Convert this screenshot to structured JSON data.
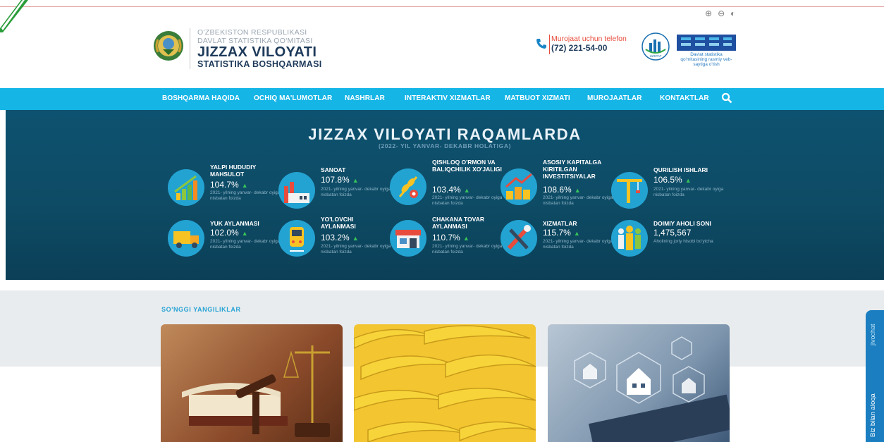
{
  "accessibility": {
    "zoom_in": "⊕",
    "zoom_out": "⊖",
    "contrast": "◐"
  },
  "header": {
    "org_line1": "O'ZBEKISTON RESPUBLIKASI",
    "org_line2": "DAVLAT STATISTIKA QO'MITASI",
    "title": "JIZZAX VILOYATI",
    "subtitle": "STATISTIKA BOSHQARMASI",
    "phone_label": "Murojaat uchun telefon",
    "phone_number": "(72) 221-54-00",
    "uzstat_label": "UZSTAT",
    "site_caption": "Davlat statistika qo'mitasining rasmiy veb-saytiga o'tish"
  },
  "nav": {
    "items": [
      "BOSHQARMA HAQIDA",
      "OCHIQ MA'LUMOTLAR",
      "NASHRLAR",
      "INTERAKTIV XIZMATLAR",
      "MATBUOT XIZMATI",
      "MUROJAATLAR",
      "KONTAKTLAR"
    ]
  },
  "hero": {
    "title": "JIZZAX VILOYATI RAQAMLARDA",
    "subtitle": "(2022- YIL YANVAR- DEKABR HOLATIGA)",
    "stats": [
      {
        "title": "YALPI HUDUDIY MAHSULOT",
        "value": "104.7%",
        "note": "2021- yilning yanvar- dekabr oyiga nisbatan foizda",
        "icon": "chart-bars-icon"
      },
      {
        "title": "SANOAT",
        "value": "107.8%",
        "note": "2021- yilning yanvar- dekabr oyiga nisbatan foizda",
        "icon": "factory-icon"
      },
      {
        "title": "QISHLOQ O'RMON VA BALIQCHILIK XO'JALIGI",
        "value": "103.4%",
        "note": "2021- yilning yanvar- dekabr oyiga nisbatan foizda",
        "icon": "wheat-gear-icon"
      },
      {
        "title": "ASOSIY KAPITALGA KIRITILGAN INVESTITSIYALAR",
        "value": "108.6%",
        "note": "2021- yilning yanvar- dekabr oyiga nisbatan foizda",
        "icon": "investment-chart-icon"
      },
      {
        "title": "QURILISH ISHLARI",
        "value": "106.5%",
        "note": "2021- yilning yanvar- dekabr oyiga nisbatan foizda",
        "icon": "crane-icon"
      },
      {
        "title": "YUK AYLANMASI",
        "value": "102.0%",
        "note": "2021- yilning yanvar- dekabr oyiga nisbatan foizda",
        "icon": "truck-icon"
      },
      {
        "title": "YO'LOVCHI AYLANMASI",
        "value": "103.2%",
        "note": "2021- yilning yanvar- dekabr oyiga nisbatan foizda",
        "icon": "train-icon"
      },
      {
        "title": "CHAKANA TOVAR AYLANMASI",
        "value": "110.7%",
        "note": "2021- yilning yanvar- dekabr oyiga nisbatan foizda",
        "icon": "shop-icon"
      },
      {
        "title": "XIZMATLAR",
        "value": "115.7%",
        "note": "2021- yilning yanvar- dekabr oyiga nisbatan foizda",
        "icon": "tools-icon"
      },
      {
        "title": "DOIMIY AHOLI SONI",
        "value": "1,475,567",
        "note": "Aholining joriy hisobi bo'yicha",
        "icon": "people-icon"
      }
    ]
  },
  "news": {
    "heading": "SO'NGGI YANGILIKLAR",
    "cards": [
      "law-books-image",
      "bananas-image",
      "smart-home-image"
    ]
  },
  "feedback": {
    "label": "Biz bilan aloqa",
    "chat": "jivochat"
  },
  "colors": {
    "nav": "#15b5e6",
    "hero": "#0d5270",
    "accent_up": "#37c25a",
    "brand_dark": "#1e3a5a"
  }
}
